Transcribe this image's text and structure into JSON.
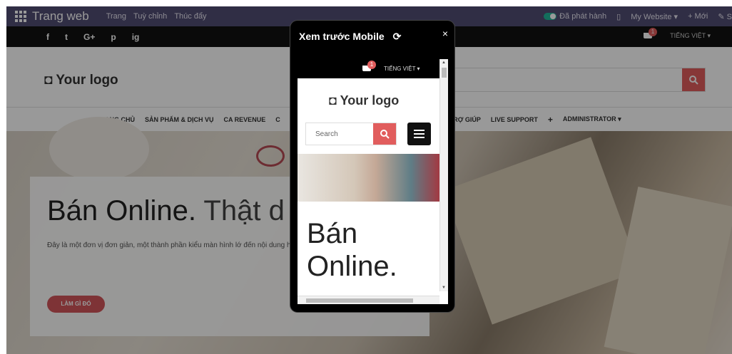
{
  "admin_bar": {
    "brand": "Trang web",
    "menus": [
      "Trang",
      "Tuỳ chỉnh",
      "Thúc đẩy"
    ],
    "published_label": "Đã phát hành",
    "website_label": "My Website ▾",
    "new_label": "+ Mới",
    "edit_label": "✎ S"
  },
  "social_bar": {
    "icons": [
      "f",
      "t",
      "G+",
      "p",
      "ig"
    ],
    "cart_count": "1",
    "language": "TIẾNG VIỆT ▾"
  },
  "header": {
    "logo_text": "Your logo"
  },
  "nav": {
    "items_left": [
      "TRANG CHỦ",
      "SẢN PHẨM & DỊCH VỤ",
      "CA REVENUE",
      "C"
    ],
    "items_right": [
      "TRỢ GIÚP",
      "LIVE SUPPORT",
      "+",
      "ADMINISTRATOR ▾"
    ]
  },
  "hero": {
    "title_bold": "Bán Online.",
    "title_light": "Thật d",
    "description": "Đây là một đơn vị đơn giản, một thành phần kiểu màn hình lớ đến nội dung hoặc thông tin nổi bật.",
    "button_label": "LÀM GÌ ĐÓ"
  },
  "modal": {
    "title": "Xem trước Mobile",
    "close_label": "×",
    "mobile": {
      "cart_count": "1",
      "language": "TIẾNG VIỆT ▾",
      "logo_text": "Your logo",
      "search_placeholder": "Search",
      "title": "Bán Online."
    }
  },
  "colors": {
    "admin_bar": "#514d73",
    "accent": "#e15d5d",
    "hero_button": "#d2555a",
    "published_toggle": "#21b799"
  }
}
